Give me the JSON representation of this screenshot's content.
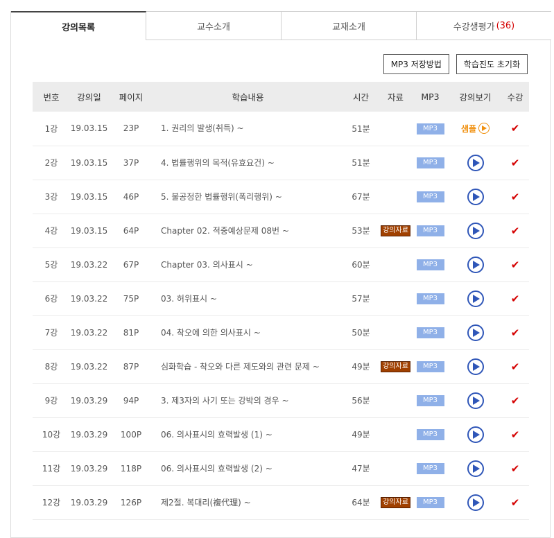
{
  "tabs": [
    {
      "label": "강의목록",
      "active": true
    },
    {
      "label": "교수소개",
      "active": false
    },
    {
      "label": "교재소개",
      "active": false
    },
    {
      "label": "수강생평가",
      "count": "(36)",
      "active": false
    }
  ],
  "buttons": {
    "mp3_save": "MP3 저장방법",
    "reset_progress": "학습진도 초기화"
  },
  "table": {
    "headers": [
      "번호",
      "강의일",
      "페이지",
      "학습내용",
      "시간",
      "자료",
      "MP3",
      "강의보기",
      "수강"
    ],
    "mp3_label": "MP3",
    "data_label": "강의자료",
    "sample_label": "샘플",
    "check_mark": "✔",
    "rows": [
      {
        "no": "1강",
        "date": "19.03.15",
        "page": "23P",
        "content": "1. 권리의 발생(취득) ~",
        "time": "51분",
        "has_data": false,
        "sample": true
      },
      {
        "no": "2강",
        "date": "19.03.15",
        "page": "37P",
        "content": "4. 법률행위의 목적(유효요건) ~",
        "time": "51분",
        "has_data": false,
        "sample": false
      },
      {
        "no": "3강",
        "date": "19.03.15",
        "page": "46P",
        "content": "5. 불공정한 법률행위(폭리행위) ~",
        "time": "67분",
        "has_data": false,
        "sample": false
      },
      {
        "no": "4강",
        "date": "19.03.15",
        "page": "64P",
        "content": "Chapter 02. 적중예상문제 08번 ~",
        "time": "53분",
        "has_data": true,
        "sample": false
      },
      {
        "no": "5강",
        "date": "19.03.22",
        "page": "67P",
        "content": "Chapter 03. 의사표시 ~",
        "time": "60분",
        "has_data": false,
        "sample": false
      },
      {
        "no": "6강",
        "date": "19.03.22",
        "page": "75P",
        "content": "03. 허위표시 ~",
        "time": "57분",
        "has_data": false,
        "sample": false
      },
      {
        "no": "7강",
        "date": "19.03.22",
        "page": "81P",
        "content": "04. 착오에 의한 의사표시 ~",
        "time": "50분",
        "has_data": false,
        "sample": false
      },
      {
        "no": "8강",
        "date": "19.03.22",
        "page": "87P",
        "content": "심화학습 - 착오와 다른 제도와의 관련 문제 ~",
        "time": "49분",
        "has_data": true,
        "sample": false
      },
      {
        "no": "9강",
        "date": "19.03.29",
        "page": "94P",
        "content": "3. 제3자의 사기 또는 강박의 경우 ~",
        "time": "56분",
        "has_data": false,
        "sample": false
      },
      {
        "no": "10강",
        "date": "19.03.29",
        "page": "100P",
        "content": "06. 의사표시의 효력발생 (1) ~",
        "time": "49분",
        "has_data": false,
        "sample": false
      },
      {
        "no": "11강",
        "date": "19.03.29",
        "page": "118P",
        "content": "06. 의사표시의 효력발생 (2) ~",
        "time": "47분",
        "has_data": false,
        "sample": false
      },
      {
        "no": "12강",
        "date": "19.03.29",
        "page": "126P",
        "content": "제2절. 복대리(複代理) ~",
        "time": "64분",
        "has_data": true,
        "sample": false
      }
    ]
  },
  "colors": {
    "accent_red": "#d40000",
    "play_blue": "#2f56b8",
    "sample_orange": "#f0900e",
    "mp3_badge": "#8fb0e8",
    "data_badge": "#a04000"
  }
}
